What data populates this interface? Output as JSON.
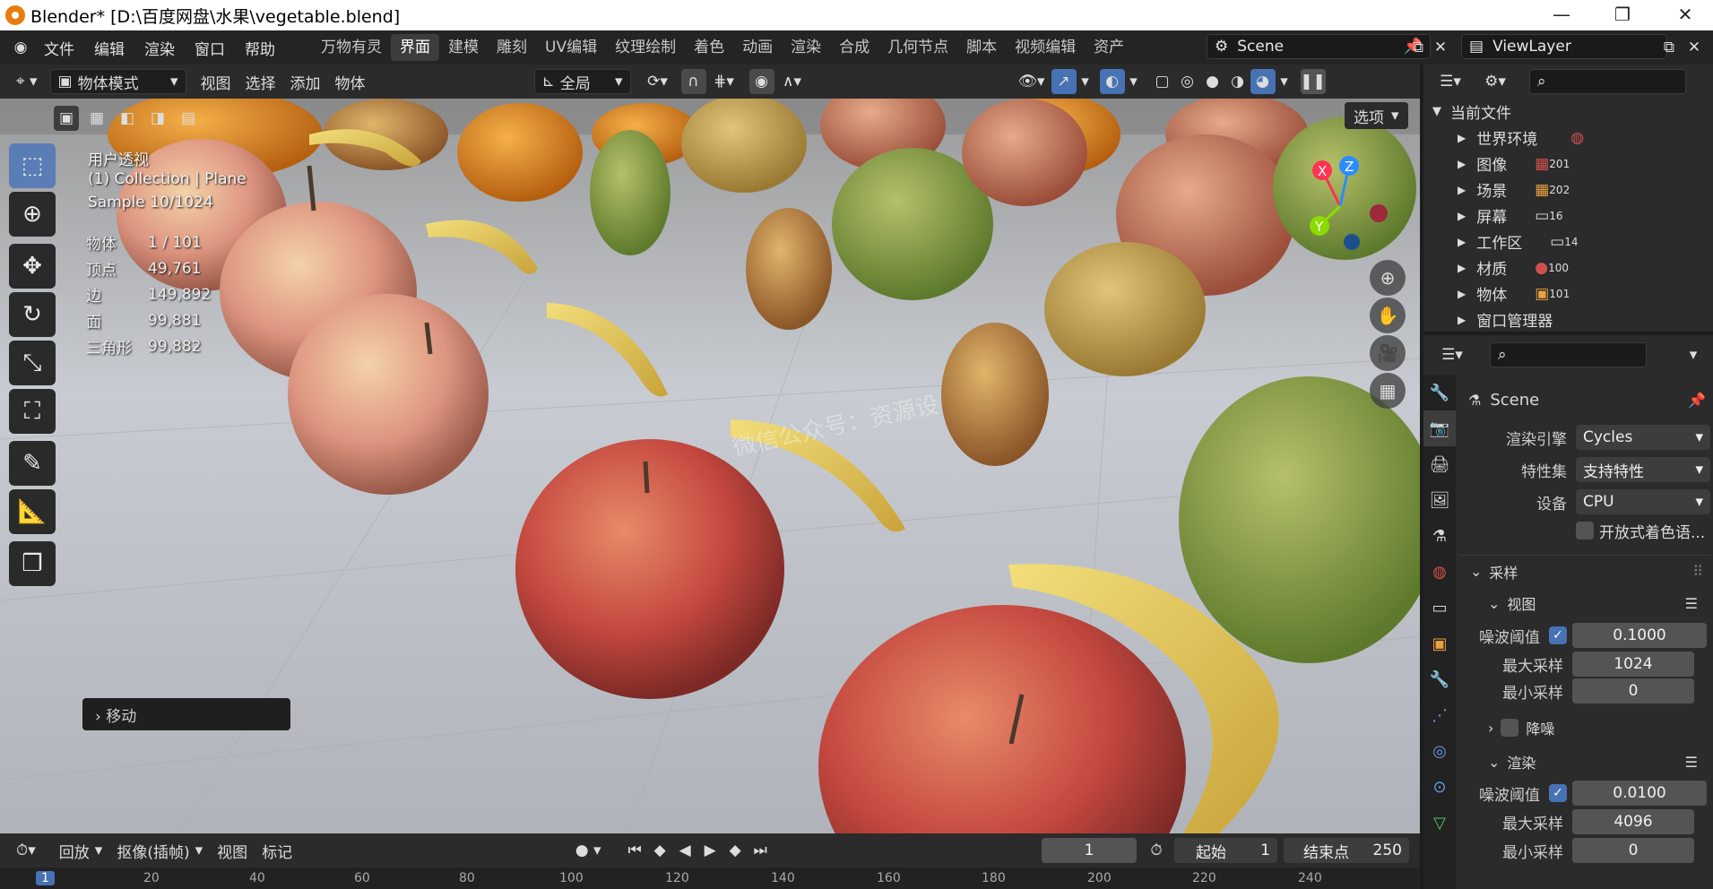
{
  "window": {
    "title": "Blender* [D:\\百度网盘\\水果\\vegetable.blend]",
    "minimize": "—",
    "maximize": "❐",
    "close": "✕"
  },
  "menus": [
    "文件",
    "编辑",
    "渲染",
    "窗口",
    "帮助"
  ],
  "workspaces": [
    "万物有灵",
    "界面",
    "建模",
    "雕刻",
    "UV编辑",
    "纹理绘制",
    "着色",
    "动画",
    "渲染",
    "合成",
    "几何节点",
    "脚本",
    "视频编辑",
    "资产"
  ],
  "active_workspace": "界面",
  "scene_field": "Scene",
  "viewlayer_field": "ViewLayer",
  "viewport_header": {
    "mode": "物体模式",
    "view": "视图",
    "select": "选择",
    "add": "添加",
    "object": "物体",
    "transform_orientation": "全局",
    "options": "选项"
  },
  "overlay_text": {
    "perspective": "用户透视",
    "collection": "(1) Collection | Plane",
    "sample": "Sample 10/1024"
  },
  "stats": [
    {
      "label": "物体",
      "value": "1 / 101"
    },
    {
      "label": "顶点",
      "value": "49,761"
    },
    {
      "label": "边",
      "value": "149,892"
    },
    {
      "label": "面",
      "value": "99,881"
    },
    {
      "label": "三角形",
      "value": "99,882"
    }
  ],
  "watermark": "微信公众号：资源设",
  "gizmo": {
    "x": "X",
    "y": "Y",
    "z": "Z"
  },
  "last_operator": "移动",
  "timeline": {
    "playback": "回放",
    "keying": "抠像(插帧)",
    "view": "视图",
    "marker": "标记",
    "current_frame": "1",
    "start_label": "起始",
    "start": "1",
    "end_label": "结束点",
    "end": "250"
  },
  "ruler_ticks": [
    "1",
    "20",
    "40",
    "60",
    "80",
    "100",
    "120",
    "140",
    "160",
    "180",
    "200",
    "220",
    "240"
  ],
  "outliner": {
    "root": "当前文件",
    "items": [
      {
        "label": "世界环境",
        "count": ""
      },
      {
        "label": "图像",
        "count": "201"
      },
      {
        "label": "场景",
        "count": "202"
      },
      {
        "label": "屏幕",
        "count": "16"
      },
      {
        "label": "工作区",
        "count": "14"
      },
      {
        "label": "材质",
        "count": "100"
      },
      {
        "label": "物体",
        "count": "101"
      },
      {
        "label": "窗口管理器",
        "count": ""
      }
    ]
  },
  "properties": {
    "context": "Scene",
    "render_engine_label": "渲染引擎",
    "render_engine": "Cycles",
    "feature_set_label": "特性集",
    "feature_set": "支持特性",
    "device_label": "设备",
    "device": "CPU",
    "osl_label": "开放式着色语...",
    "sampling": "采样",
    "viewport_section": "视图",
    "noise_threshold_label": "噪波阈值",
    "viewport_noise_threshold": "0.1000",
    "max_samples_label": "最大采样",
    "viewport_max_samples": "1024",
    "min_samples_label": "最小采样",
    "viewport_min_samples": "0",
    "denoise_label": "降噪",
    "render_section": "渲染",
    "render_noise_threshold": "0.0100",
    "render_max_samples": "4096",
    "render_min_samples": "0"
  },
  "colors": {
    "accent": "#4772b3",
    "active_tool": "#5a7db5",
    "panel": "#2b2b2b"
  }
}
